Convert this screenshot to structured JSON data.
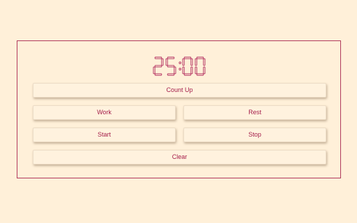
{
  "timer": {
    "display": "25:00",
    "color": "#b0285a"
  },
  "buttons": {
    "count_up": "Count Up",
    "work": "Work",
    "rest": "Rest",
    "start": "Start",
    "stop": "Stop",
    "clear": "Clear"
  },
  "colors": {
    "background": "#fff0d9",
    "accent": "#a51e4a"
  }
}
